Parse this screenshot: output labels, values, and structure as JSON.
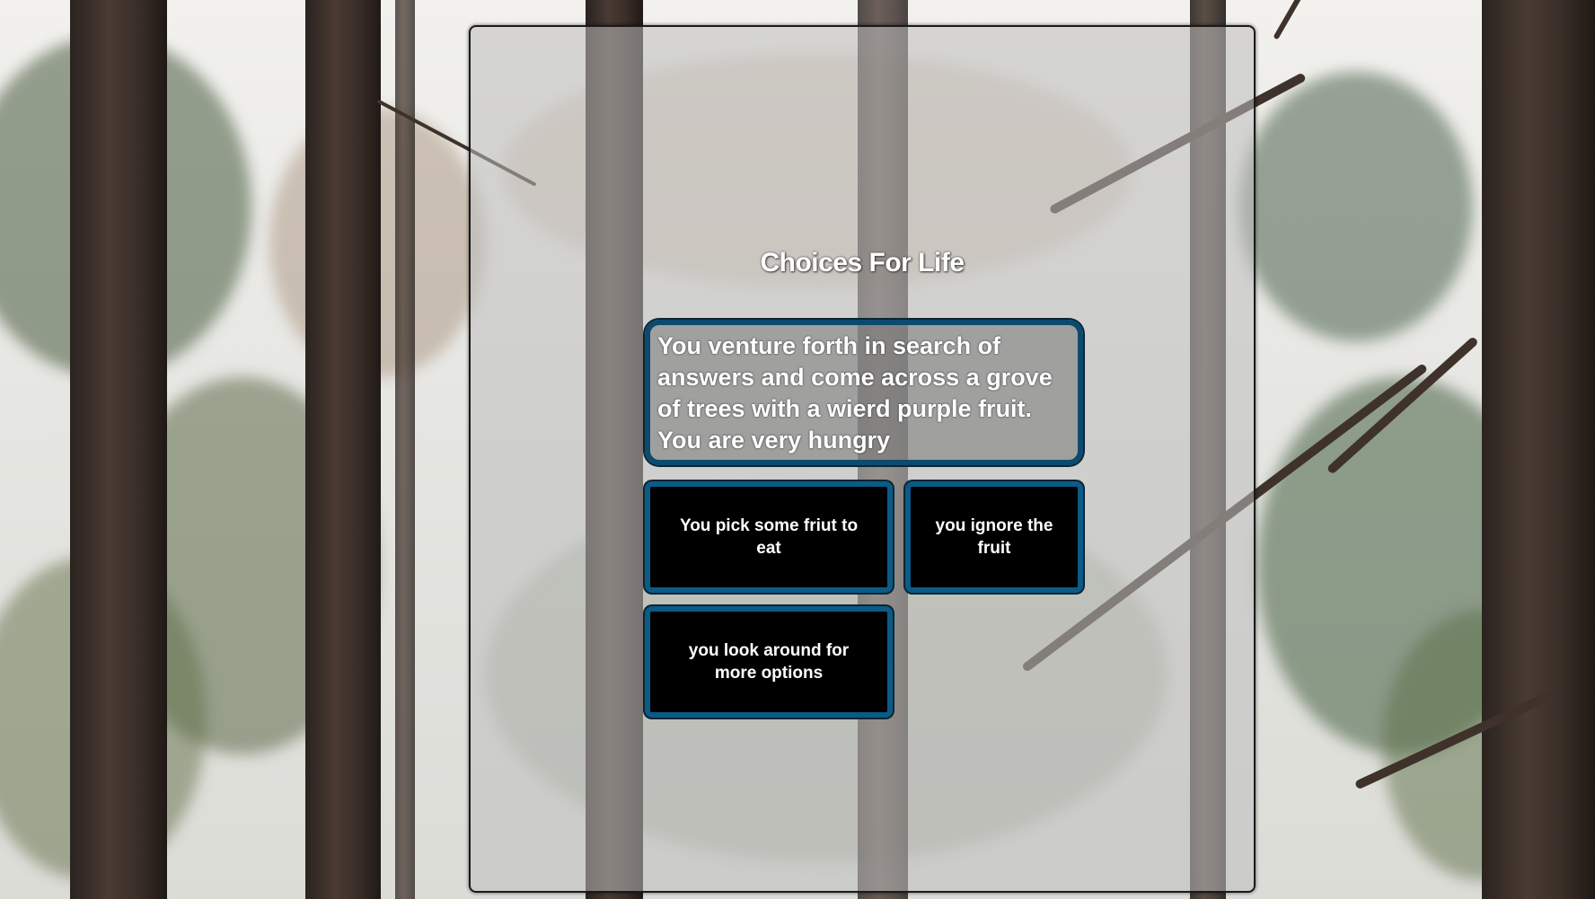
{
  "game": {
    "title": "Choices For Life",
    "story_text": "You venture forth in search of answers and come across a grove of trees with a wierd purple fruit. You are very hungry",
    "choices": [
      {
        "label": "You pick some friut to eat"
      },
      {
        "label": "you ignore the fruit"
      },
      {
        "label": "you look around for more options"
      }
    ]
  },
  "colors": {
    "button_border": "#0c5a86",
    "button_background": "#000000",
    "text": "#ffffff"
  }
}
